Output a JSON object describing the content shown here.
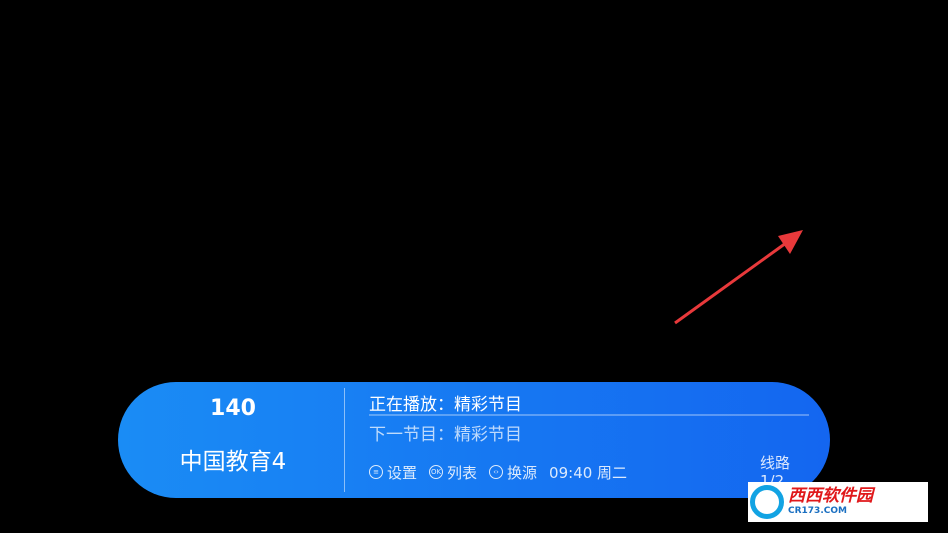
{
  "channel": {
    "number": "140",
    "name": "中国教育4"
  },
  "epg": {
    "now_playing": "正在播放：精彩节目",
    "next": "下一节目：精彩节目",
    "progress": 0.0
  },
  "hints": [
    {
      "key": "≡",
      "icon": "menu-icon",
      "label": "设置"
    },
    {
      "key": "OK",
      "icon": "ok-icon",
      "label": "列表"
    },
    {
      "key": "‹›",
      "icon": "left-right-icon",
      "label": "换源"
    }
  ],
  "clock": "09:40 周二",
  "line": {
    "label": "线路",
    "value": "1/2"
  },
  "watermark": {
    "title": "西西软件园",
    "subtitle": "CR173.COM"
  },
  "colors": {
    "panel": "#1677f2",
    "arrow": "#e8393b",
    "background": "#000000"
  }
}
